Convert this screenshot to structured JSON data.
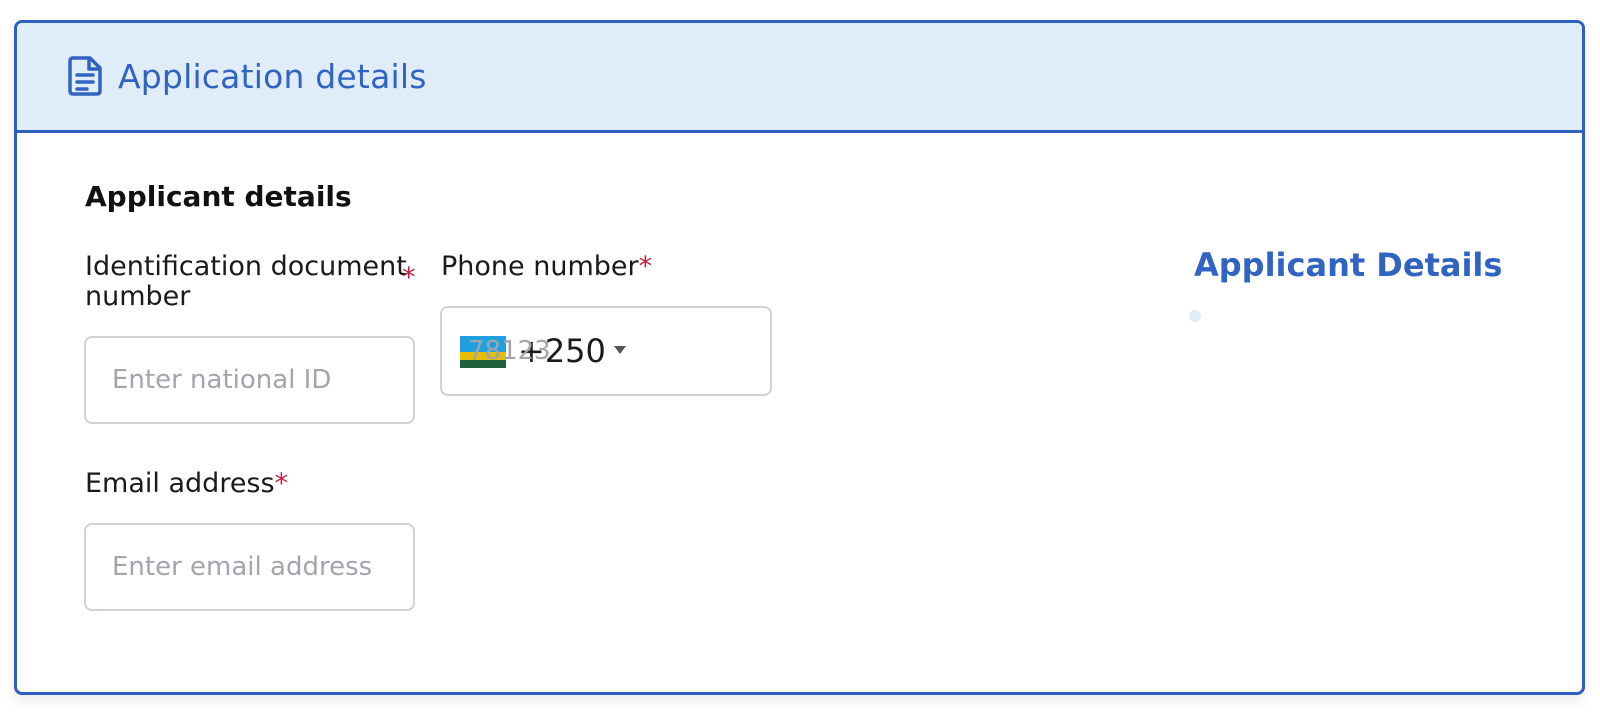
{
  "header": {
    "title": "Application details",
    "icon": "document-icon"
  },
  "section": {
    "title": "Applicant details"
  },
  "fields": {
    "id_number": {
      "label_line1": "Identification document",
      "label_line2": "number",
      "required_mark": "*",
      "placeholder": "Enter national ID"
    },
    "phone": {
      "label": "Phone number",
      "required_mark": "*",
      "country_flag": "rwanda-flag-icon",
      "dial_code": "+250",
      "placeholder": "78123"
    },
    "email": {
      "label": "Email address",
      "required_mark": "*",
      "placeholder": "Enter email address"
    }
  },
  "sidebar": {
    "title": "Applicant Details"
  },
  "colors": {
    "accent": "#2f5fbf",
    "header_bg": "#e1ecf9",
    "required": "#c41f3e"
  }
}
